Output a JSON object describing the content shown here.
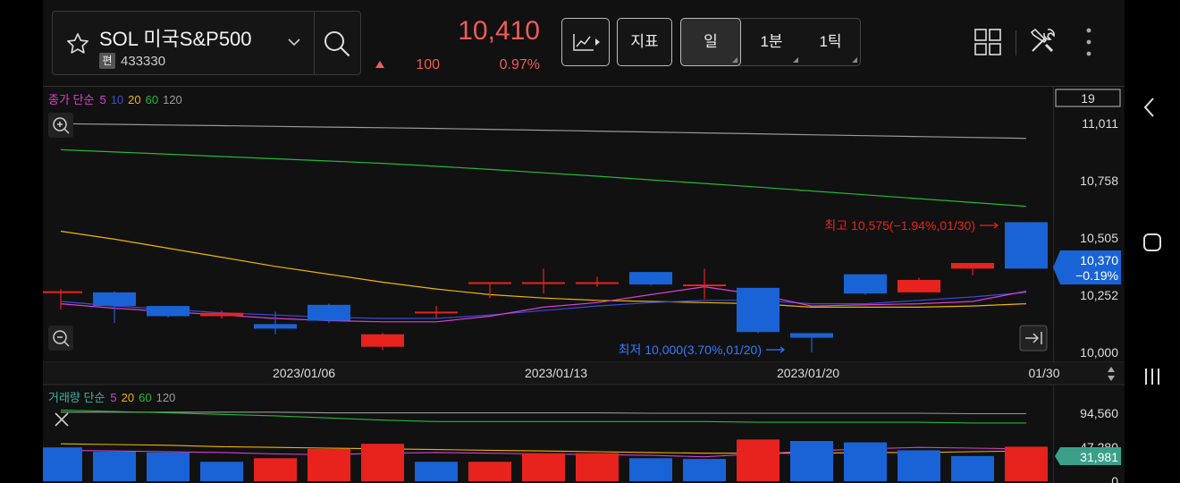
{
  "header": {
    "stock_name": "SOL 미국S&P500",
    "badge": "편",
    "code": "433330",
    "price": "10,410",
    "change": "100",
    "change_pct": "0.97%",
    "btn_indicator": "지표",
    "timeframes": [
      "일",
      "1분",
      "1틱"
    ],
    "selected_timeframe": "일"
  },
  "colors": {
    "up": "#e8231e",
    "down": "#1a63d6",
    "ma5": "#d93fd4",
    "ma10": "#3b4bd8",
    "ma20": "#f0b400",
    "ma60": "#22b83a",
    "ma120": "#9a9a9a",
    "price_tag": "#1a63d6",
    "vol_tag": "#3aa08a"
  },
  "chart_data": [
    {
      "type": "candlestick",
      "legend": {
        "prefix": "종가 단순",
        "periods": [
          "5",
          "10",
          "20",
          "60",
          "120"
        ]
      },
      "visible_count": "19",
      "y_ticks": [
        "11,011",
        "10,758",
        "10,505",
        "10,252",
        "10,000"
      ],
      "ylim": [
        10000,
        11011
      ],
      "x_labels": [
        {
          "text": "2023/01/06",
          "index": 4.5
        },
        {
          "text": "2023/01/13",
          "index": 9.2
        },
        {
          "text": "2023/01/20",
          "index": 13.9
        },
        {
          "text": "01/30",
          "index": 18.3
        }
      ],
      "candles": [
        {
          "o": 10270,
          "h": 10280,
          "l": 10190,
          "c": 10270
        },
        {
          "o": 10265,
          "h": 10270,
          "l": 10130,
          "c": 10205
        },
        {
          "o": 10205,
          "h": 10205,
          "l": 10155,
          "c": 10160
        },
        {
          "o": 10160,
          "h": 10185,
          "l": 10150,
          "c": 10175
        },
        {
          "o": 10125,
          "h": 10180,
          "l": 10080,
          "c": 10105
        },
        {
          "o": 10210,
          "h": 10215,
          "l": 10130,
          "c": 10140
        },
        {
          "o": 10025,
          "h": 10085,
          "l": 10010,
          "c": 10080
        },
        {
          "o": 10180,
          "h": 10205,
          "l": 10150,
          "c": 10180
        },
        {
          "o": 10310,
          "h": 10310,
          "l": 10240,
          "c": 10310
        },
        {
          "o": 10310,
          "h": 10370,
          "l": 10260,
          "c": 10310
        },
        {
          "o": 10310,
          "h": 10335,
          "l": 10290,
          "c": 10310
        },
        {
          "o": 10355,
          "h": 10355,
          "l": 10295,
          "c": 10300
        },
        {
          "o": 10300,
          "h": 10370,
          "l": 10235,
          "c": 10300
        },
        {
          "o": 10285,
          "h": 10285,
          "l": 10085,
          "c": 10090
        },
        {
          "o": 10085,
          "h": 10085,
          "l": 10000,
          "c": 10065
        },
        {
          "o": 10345,
          "h": 10345,
          "l": 10255,
          "c": 10260
        },
        {
          "o": 10265,
          "h": 10330,
          "l": 10265,
          "c": 10320
        },
        {
          "o": 10370,
          "h": 10380,
          "l": 10340,
          "c": 10395
        },
        {
          "o": 10575,
          "h": 10575,
          "l": 10370,
          "c": 10370
        }
      ],
      "ma_lines": [
        {
          "period": "5",
          "points": [
            10215,
            10195,
            10180,
            10165,
            10150,
            10140,
            10135,
            10135,
            10160,
            10200,
            10220,
            10255,
            10290,
            10255,
            10205,
            10210,
            10215,
            10225,
            10270
          ]
        },
        {
          "period": "10",
          "points": [
            10225,
            10205,
            10190,
            10175,
            10165,
            10155,
            10150,
            10150,
            10165,
            10185,
            10205,
            10220,
            10230,
            10230,
            10215,
            10215,
            10230,
            10245,
            10265
          ]
        },
        {
          "period": "20",
          "points": [
            10535,
            10500,
            10460,
            10420,
            10380,
            10345,
            10310,
            10280,
            10255,
            10240,
            10230,
            10225,
            10220,
            10215,
            10200,
            10200,
            10200,
            10205,
            10215
          ]
        },
        {
          "period": "60",
          "points": [
            10895,
            10885,
            10875,
            10865,
            10855,
            10845,
            10835,
            10822,
            10808,
            10793,
            10778,
            10762,
            10746,
            10730,
            10713,
            10696,
            10679,
            10662,
            10645
          ]
        },
        {
          "period": "120",
          "points": [
            11010,
            11007,
            11004,
            11001,
            10998,
            10995,
            10992,
            10989,
            10985,
            10981,
            10977,
            10973,
            10969,
            10965,
            10961,
            10957,
            10953,
            10949,
            10945
          ]
        }
      ],
      "high_annotation": "최고 10,575(−1.94%,01/30)",
      "low_annotation": "최저 10,000(3.70%,01/20)",
      "price_tag": {
        "price": "10,370",
        "pct": "−0.19%",
        "value": 10370
      }
    },
    {
      "type": "bar",
      "legend": {
        "prefix": "거래량 단순",
        "periods": [
          "5",
          "20",
          "60",
          "120"
        ]
      },
      "y_ticks": [
        "94,560",
        "47,280",
        "0"
      ],
      "ylim": [
        0,
        94560
      ],
      "values": [
        47000,
        41000,
        40000,
        27000,
        32000,
        45000,
        52000,
        27000,
        27000,
        39000,
        39000,
        32000,
        31000,
        58000,
        56000,
        54000,
        43000,
        35000,
        48000
      ],
      "colors": [
        "down",
        "down",
        "down",
        "down",
        "up",
        "up",
        "up",
        "down",
        "up",
        "up",
        "up",
        "down",
        "down",
        "up",
        "down",
        "down",
        "down",
        "down",
        "up"
      ],
      "ma_lines": [
        {
          "period": "5",
          "points": [
            43000,
            42000,
            41000,
            40000,
            38000,
            37000,
            39000,
            40000,
            39000,
            38000,
            37000,
            36000,
            34000,
            38000,
            42000,
            45000,
            47000,
            46000,
            45000
          ]
        },
        {
          "period": "20",
          "points": [
            52000,
            51000,
            50000,
            48000,
            47000,
            46000,
            45000,
            44000,
            43000,
            42000,
            41000,
            40000,
            39000,
            39000,
            39000,
            40000,
            40000,
            41000,
            42000
          ]
        },
        {
          "period": "60",
          "points": [
            99000,
            97000,
            95000,
            93000,
            91000,
            88000,
            85000,
            83000,
            83000,
            83000,
            83000,
            83000,
            83000,
            82000,
            82000,
            82000,
            82000,
            81000,
            81000
          ]
        },
        {
          "period": "120",
          "points": [
            96000,
            96000,
            96000,
            96000,
            96000,
            95000,
            95000,
            95000,
            95000,
            95000,
            95000,
            94500,
            94500,
            94500,
            94500,
            94500,
            94500,
            94000,
            94000
          ]
        }
      ],
      "last_value": "31,981",
      "last_value_num": 31981
    }
  ]
}
